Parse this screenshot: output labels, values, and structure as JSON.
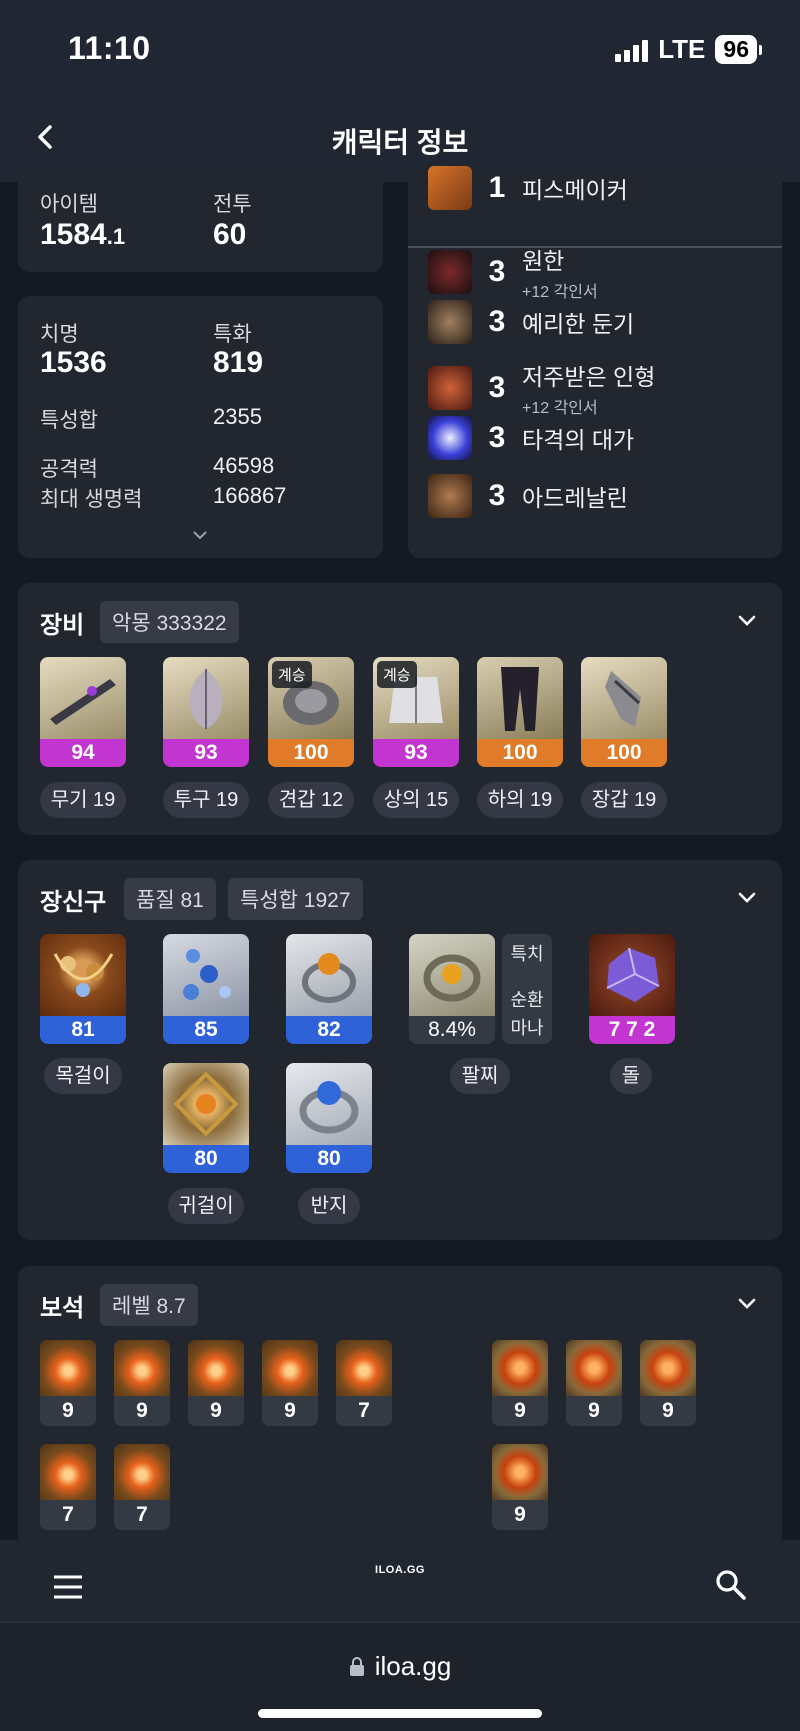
{
  "status_bar": {
    "time": "11:10",
    "network": "LTE",
    "battery": "96"
  },
  "header": {
    "title": "캐릭터 정보"
  },
  "profile": {
    "item_label": "아이템",
    "item_value": "1584",
    "item_decimal": ".1",
    "combat_label": "전투",
    "combat_value": "60"
  },
  "stats": {
    "crit_label": "치명",
    "crit_value": "1536",
    "spec_label": "특화",
    "spec_value": "819",
    "total_label": "특성합",
    "total_value": "2355",
    "attack_label": "공격력",
    "attack_value": "46598",
    "hp_label": "최대 생명력",
    "hp_value": "166867"
  },
  "engravings": [
    {
      "level": "1",
      "name": "피스메이커",
      "sub": "",
      "icon": "gun-icon"
    },
    {
      "level": "3",
      "name": "원한",
      "sub": "+12 각인서",
      "icon": "demon-icon"
    },
    {
      "level": "3",
      "name": "예리한 둔기",
      "sub": "",
      "icon": "mace-icon"
    },
    {
      "level": "3",
      "name": "저주받은 인형",
      "sub": "+12 각인서",
      "icon": "doll-icon"
    },
    {
      "level": "3",
      "name": "타격의 대가",
      "sub": "",
      "icon": "lightning-icon"
    },
    {
      "level": "3",
      "name": "아드레날린",
      "sub": "",
      "icon": "adrenaline-icon"
    }
  ],
  "equipment": {
    "title": "장비",
    "badge": "악몽 333322",
    "items": [
      {
        "quality": "94",
        "slot": "무기 19",
        "tag": "",
        "color": "#c235d0"
      },
      {
        "quality": "93",
        "slot": "투구 19",
        "tag": "",
        "color": "#c235d0"
      },
      {
        "quality": "100",
        "slot": "견갑 12",
        "tag": "계승",
        "color": "#e07b2a"
      },
      {
        "quality": "93",
        "slot": "상의 15",
        "tag": "계승",
        "color": "#c235d0"
      },
      {
        "quality": "100",
        "slot": "하의 19",
        "tag": "",
        "color": "#e07b2a"
      },
      {
        "quality": "100",
        "slot": "장갑 19",
        "tag": "",
        "color": "#e07b2a"
      }
    ]
  },
  "accessories": {
    "title": "장신구",
    "quality_badge": "품질 81",
    "total_badge": "특성합 1927",
    "necklace": {
      "quality": "81",
      "label": "목걸이"
    },
    "earring1": {
      "quality": "85"
    },
    "earring2": {
      "quality": "80"
    },
    "earring_label": "귀걸이",
    "ring1": {
      "quality": "82"
    },
    "ring2": {
      "quality": "80"
    },
    "ring_label": "반지",
    "bracelet": {
      "value": "8.4%",
      "label": "팔찌",
      "opt1": "특치",
      "opt2": "순환",
      "opt3": "마나"
    },
    "stone": {
      "value": "7 7 2",
      "label": "돌"
    }
  },
  "gems": {
    "title": "보석",
    "badge": "레벨 8.7",
    "dmg_gems": [
      "9",
      "9",
      "9",
      "9",
      "7",
      "7",
      "7"
    ],
    "cd_gems": [
      "9",
      "9",
      "9",
      "9"
    ]
  },
  "bottom": {
    "logo": "ILOA.GG",
    "url": "iloa.gg"
  },
  "colors": {
    "quality_blue": "#2f62d8",
    "quality_purple": "#c235d0",
    "quality_orange": "#e07b2a"
  }
}
